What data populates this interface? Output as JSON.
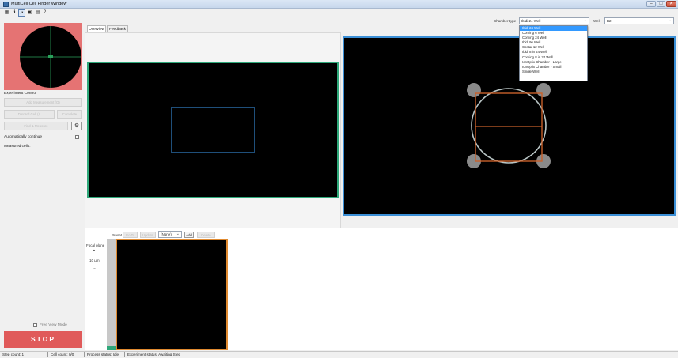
{
  "window": {
    "title": "MultiCell Cell Finder Window",
    "controls": [
      "–",
      "□",
      "✕"
    ]
  },
  "toolbar": {
    "icons": [
      "grid-icon",
      "info-icon",
      "pointer-icon",
      "save-icon",
      "save-as-icon",
      "help-icon"
    ],
    "glyphs": [
      "▦",
      "ℹ",
      "➚",
      "▣",
      "▤",
      "?"
    ]
  },
  "chamber": {
    "label": "Chamber type",
    "value": "Ibidi 24 Well",
    "options": [
      "Ibidi 24 Well",
      "Corning 6 Well",
      "Corning 24 Well",
      "Ibidi 96 Well",
      "Costar 12 Well",
      "Ibidi 8 in 24 Well",
      "Corning 8 in 24 Well",
      "IonOptix Chamber - Large",
      "IonOptix Chamber - Small",
      "Single Well"
    ],
    "selected_index": 0
  },
  "well": {
    "label": "Well",
    "value": "B2"
  },
  "tabs": [
    {
      "label": "Overview",
      "active": true
    },
    {
      "label": "Feedback",
      "active": false
    }
  ],
  "experiment": {
    "title": "Experiment Control",
    "add_measurement": "Add Measurement (Q)",
    "discard": "Discard Cell (I)",
    "complete": "Complete",
    "find_measure": "Find & Measure",
    "auto_continue": "Automatically continue",
    "measured_cells": "Measured cells:",
    "free_view": "Free View Mode",
    "stop": "STOP"
  },
  "preset": {
    "label": "Preset",
    "go_to": "Go To",
    "update": "Update",
    "value": "(None)",
    "add": "Add",
    "delete": "Delete"
  },
  "focal": {
    "label": "Focal plane",
    "value": "10 µm",
    "up": "⌃",
    "down": "⌄"
  },
  "status": {
    "step_count": "Step count: 1",
    "cell_count": "Cell count: 0/0",
    "process": "Process status: Idle",
    "experiment": "Experiment status: Awaiting Step"
  },
  "colors": {
    "overview_border": "#2ea87a",
    "chamber_border": "#3b8fd6",
    "well_outline": "#c8602a",
    "circle": "#b9c5c5",
    "fov_rect": "#1f4f7a",
    "stop_red": "#e05a5a"
  }
}
